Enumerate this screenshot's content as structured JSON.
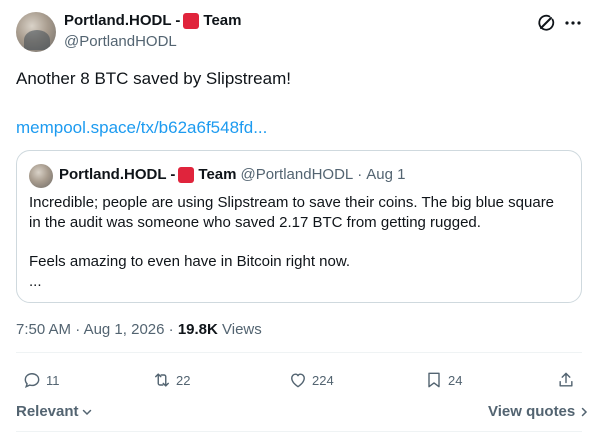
{
  "author": {
    "name": "Portland.HODL - ",
    "team": "Team",
    "handle": "@PortlandHODL"
  },
  "tweet": {
    "text": "Another 8 BTC saved by Slipstream!",
    "link": "mempool.space/tx/b62a6f548fd..."
  },
  "quote": {
    "name": "Portland.HODL - ",
    "team": "Team",
    "handle": "@PortlandHODL",
    "separator": "·",
    "date": "Aug 1",
    "lines": [
      "Incredible; people are using Slipstream to save their coins. The big blue square",
      "in the audit was someone who saved 2.17 BTC from getting rugged.",
      "Feels amazing to even have in Bitcoin right now.",
      "..."
    ]
  },
  "meta": {
    "time": "7:50 AM",
    "separator": " · ",
    "date": "Aug 1, 2026",
    "views_count": "19.8K",
    "views_label": "Views"
  },
  "actions": {
    "replies": "11",
    "reposts": "22",
    "likes": "224",
    "bookmarks": "24"
  },
  "footer": {
    "sort_label": "Relevant",
    "view_quotes": "View quotes"
  },
  "colors": {
    "link": "#1d9bf0",
    "flag": "#e0243c",
    "secondary_text": "#536471"
  },
  "icons": [
    "grok-icon",
    "more-icon",
    "reply-icon",
    "repost-icon",
    "like-icon",
    "bookmark-icon",
    "share-icon",
    "chevron-down-icon",
    "chevron-right-icon"
  ]
}
